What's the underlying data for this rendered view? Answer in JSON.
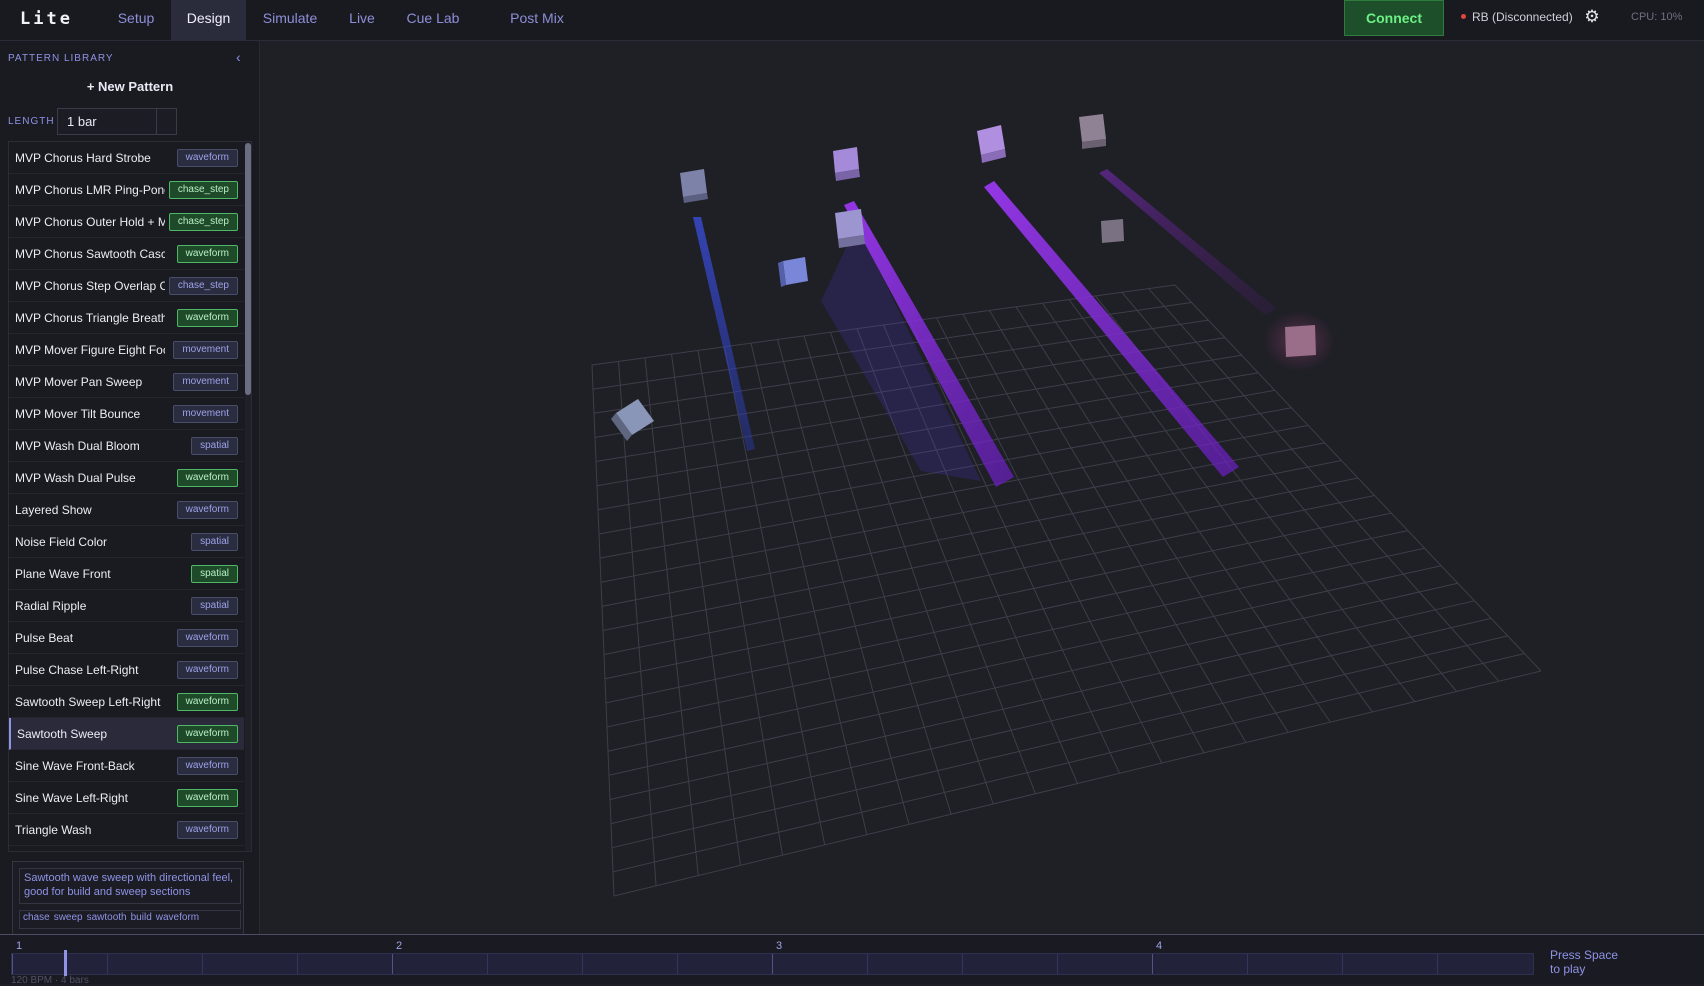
{
  "app": {
    "name": "Lite"
  },
  "nav": {
    "tabs": [
      {
        "label": "Setup",
        "active": false
      },
      {
        "label": "Design",
        "active": true
      },
      {
        "label": "Simulate",
        "active": false
      },
      {
        "label": "Live",
        "active": false
      },
      {
        "label": "Cue Lab",
        "active": false
      },
      {
        "label": "Post Mix",
        "active": false
      }
    ],
    "connect_label": "Connect",
    "status_text": "RB (Disconnected)",
    "cpu_text": "CPU: 10%"
  },
  "sidebar": {
    "title": "PATTERN LIBRARY",
    "new_pattern_label": "+ New Pattern",
    "length_label": "LENGTH",
    "length_value": "1 bar",
    "patterns": [
      {
        "name": "MVP Chorus Hard Strobe",
        "tag": "waveform",
        "tag_active": false,
        "selected": false
      },
      {
        "name": "MVP Chorus LMR Ping-Pong",
        "tag": "chase_step",
        "tag_active": true,
        "selected": false
      },
      {
        "name": "MVP Chorus Outer Hold + Mid",
        "tag": "chase_step",
        "tag_active": true,
        "selected": false
      },
      {
        "name": "MVP Chorus Sawtooth Cascade",
        "tag": "waveform",
        "tag_active": true,
        "selected": false
      },
      {
        "name": "MVP Chorus Step Overlap Chase",
        "tag": "chase_step",
        "tag_active": false,
        "selected": false
      },
      {
        "name": "MVP Chorus Triangle Breath",
        "tag": "waveform",
        "tag_active": true,
        "selected": false
      },
      {
        "name": "MVP Mover Figure Eight Focus",
        "tag": "movement",
        "tag_active": false,
        "selected": false
      },
      {
        "name": "MVP Mover Pan Sweep",
        "tag": "movement",
        "tag_active": false,
        "selected": false
      },
      {
        "name": "MVP Mover Tilt Bounce",
        "tag": "movement",
        "tag_active": false,
        "selected": false
      },
      {
        "name": "MVP Wash Dual Bloom",
        "tag": "spatial",
        "tag_active": false,
        "selected": false
      },
      {
        "name": "MVP Wash Dual Pulse",
        "tag": "waveform",
        "tag_active": true,
        "selected": false
      },
      {
        "name": "Layered Show",
        "tag": "waveform",
        "tag_active": false,
        "selected": false
      },
      {
        "name": "Noise Field Color",
        "tag": "spatial",
        "tag_active": false,
        "selected": false
      },
      {
        "name": "Plane Wave Front",
        "tag": "spatial",
        "tag_active": true,
        "selected": false
      },
      {
        "name": "Radial Ripple",
        "tag": "spatial",
        "tag_active": false,
        "selected": false
      },
      {
        "name": "Pulse Beat",
        "tag": "waveform",
        "tag_active": false,
        "selected": false
      },
      {
        "name": "Pulse Chase Left-Right",
        "tag": "waveform",
        "tag_active": false,
        "selected": false
      },
      {
        "name": "Sawtooth Sweep Left-Right",
        "tag": "waveform",
        "tag_active": true,
        "selected": false
      },
      {
        "name": "Sawtooth Sweep",
        "tag": "waveform",
        "tag_active": true,
        "selected": true
      },
      {
        "name": "Sine Wave Front-Back",
        "tag": "waveform",
        "tag_active": false,
        "selected": false
      },
      {
        "name": "Sine Wave Left-Right",
        "tag": "waveform",
        "tag_active": true,
        "selected": false
      },
      {
        "name": "Triangle Wash",
        "tag": "waveform",
        "tag_active": false,
        "selected": false
      }
    ],
    "description": "Sawtooth wave sweep with directional feel, good for build and sweep sections",
    "tags": [
      "chase",
      "sweep",
      "sawtooth",
      "build",
      "waveform"
    ]
  },
  "timeline": {
    "bar_markers": [
      "1",
      "2",
      "3",
      "4"
    ],
    "hint": "Press Space to play",
    "info": "120 BPM · 4 bars",
    "playhead_bar_fraction": 0.04
  },
  "colors": {
    "accent": "#8f93e6",
    "active_tag": "#4fb866",
    "connect": "#6df086",
    "beam_blue": "#3a4fd8",
    "beam_purple": "#8a2bd8"
  }
}
